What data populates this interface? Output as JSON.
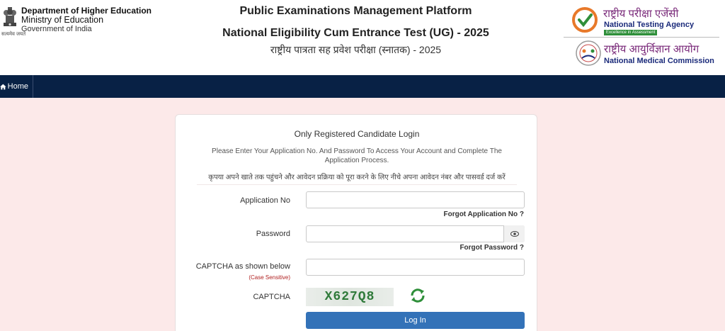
{
  "header": {
    "dept_name": "Department of Higher Education",
    "ministry": "Ministry of Education",
    "government": "Government of India",
    "emblem_caption": "सत्यमेव जयते",
    "title_line1": "Public Examinations Management Platform",
    "title_line2": "National Eligibility Cum Entrance Test (UG) - 2025",
    "title_line3": "राष्ट्रीय पात्रता सह प्रवेश परीक्षा (स्नातक) - 2025",
    "nta_hindi": "राष्ट्रीय परीक्षा एजेंसी",
    "nta_english": "National Testing Agency",
    "nta_tagline": "Excellence in Assessment",
    "nmc_hindi": "राष्ट्रीय आयुर्विज्ञान आयोग",
    "nmc_english": "National Medical Commission"
  },
  "nav": {
    "home_label": "Home"
  },
  "login": {
    "title": "Only Registered Candidate Login",
    "description": "Please Enter Your Application No. And Password To Access Your Account and Complete The Application Process.",
    "description_hindi": "कृपया अपने खाते तक पहुंचने और आवेदन प्रक्रिया को पूरा करने के लिए नीचे अपना आवेदन नंबर और पासवर्ड दर्ज करें",
    "application_no_label": "Application No",
    "application_no_value": "",
    "forgot_application_label": "Forgot Application No ?",
    "password_label": "Password",
    "password_value": "",
    "forgot_password_label": "Forgot Password ?",
    "captcha_input_label": "CAPTCHA as shown below",
    "case_sensitive_note": "(Case Sensitive)",
    "captcha_input_value": "",
    "captcha_label": "CAPTCHA",
    "captcha_text": "X627Q8",
    "login_button": "Log In"
  },
  "colors": {
    "page_background": "#fce9e9",
    "navbar": "#082145",
    "button": "#3372b8",
    "captcha_text": "#2f7a3a",
    "case_note": "#b02020"
  }
}
